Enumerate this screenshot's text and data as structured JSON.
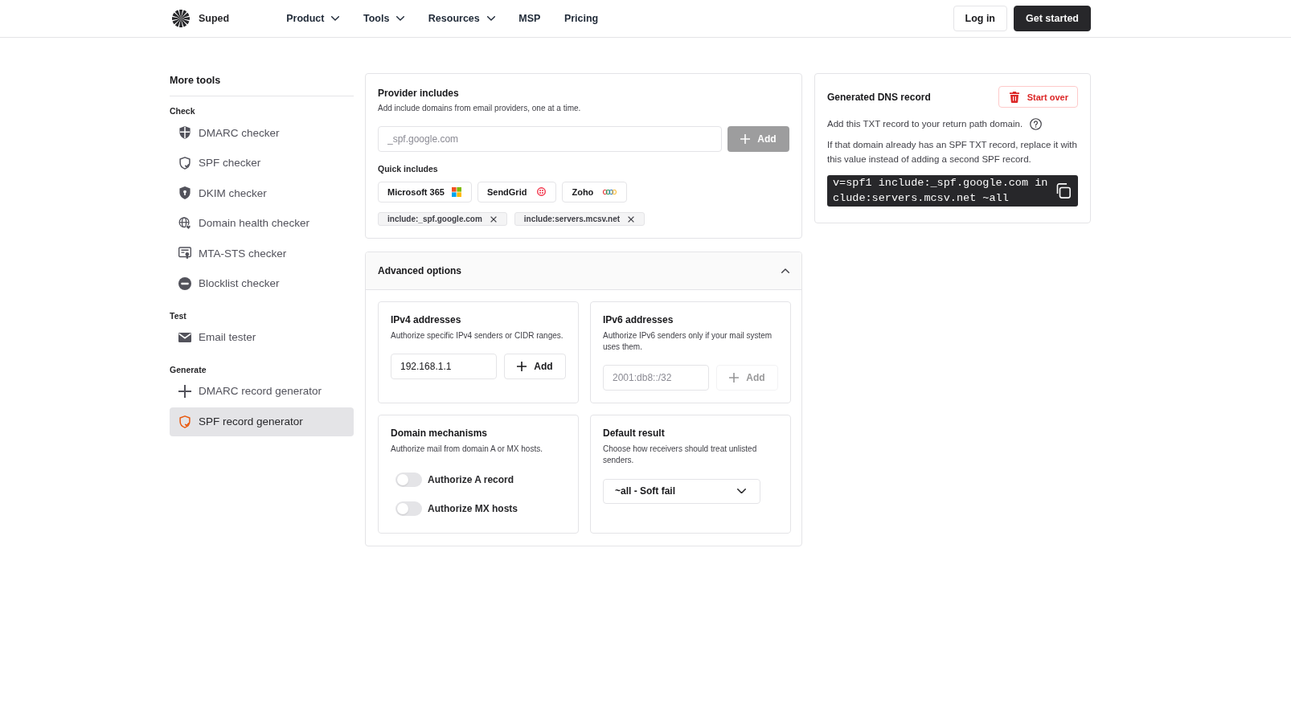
{
  "navbar": {
    "brand": "Suped",
    "menu": [
      {
        "label": "Product",
        "has_dropdown": true
      },
      {
        "label": "Tools",
        "has_dropdown": true
      },
      {
        "label": "Resources",
        "has_dropdown": true
      },
      {
        "label": "MSP",
        "has_dropdown": false
      },
      {
        "label": "Pricing",
        "has_dropdown": false
      }
    ],
    "login_button": "Log in",
    "cta_button": "Get started"
  },
  "sidebar": {
    "title": "More tools",
    "sections": [
      {
        "heading": "Check",
        "items": [
          {
            "label": "DMARC checker",
            "selected": false
          },
          {
            "label": "SPF checker",
            "selected": false
          },
          {
            "label": "DKIM checker",
            "selected": false
          },
          {
            "label": "Domain health checker",
            "selected": false
          },
          {
            "label": "MTA-STS checker",
            "selected": false
          },
          {
            "label": "Blocklist checker",
            "selected": false
          }
        ]
      },
      {
        "heading": "Test",
        "items": [
          {
            "label": "Email tester",
            "selected": false
          }
        ]
      },
      {
        "heading": "Generate",
        "items": [
          {
            "label": "DMARC record generator",
            "selected": false
          },
          {
            "label": "SPF record generator",
            "selected": true
          }
        ]
      }
    ]
  },
  "provider_includes": {
    "title": "Provider includes",
    "subtitle": "Add include domains from email providers, one at a time.",
    "input": {
      "placeholder": "_spf.google.com"
    },
    "add_button": {
      "label": "Add",
      "disabled": true
    },
    "quick_includes": {
      "title": "Quick includes",
      "items": [
        "Microsoft 365",
        "SendGrid",
        "Zoho"
      ]
    },
    "tags": [
      "include:_spf.google.com",
      "include:servers.mcsv.net"
    ]
  },
  "advanced_options": {
    "title": "Advanced options",
    "expanded": true,
    "panels": [
      {
        "kind": "address",
        "title": "IPv4 addresses",
        "subtitle": "Authorize specific IPv4 senders or CIDR ranges.",
        "input": {
          "value": "192.168.1.1"
        },
        "add_button": {
          "label": "Add",
          "disabled": false
        }
      },
      {
        "kind": "address",
        "title": "IPv6 addresses",
        "subtitle": "Authorize IPv6 senders only if your mail system uses them.",
        "input": {
          "placeholder": "2001:db8::/32"
        },
        "add_button": {
          "label": "Add",
          "disabled": true
        }
      },
      {
        "kind": "toggles",
        "title": "Domain mechanisms",
        "subtitle": "Authorize mail from domain A or MX hosts.",
        "toggles": [
          {
            "label": "Authorize A record",
            "on": false
          },
          {
            "label": "Authorize MX hosts",
            "on": false
          }
        ]
      },
      {
        "kind": "select",
        "title": "Default result",
        "subtitle": "Choose how receivers should treat unlisted senders.",
        "select": {
          "value": "~all - Soft fail"
        }
      }
    ]
  },
  "generated_record": {
    "title": "Generated DNS record",
    "start_over_button": "Start over",
    "description": "Add this TXT record to your return path domain.",
    "note": "If that domain already has an SPF TXT record, replace it with this value instead of adding a second SPF record.",
    "record": "v=spf1 include:_spf.google.com include:servers.mcsv.net ~all"
  }
}
